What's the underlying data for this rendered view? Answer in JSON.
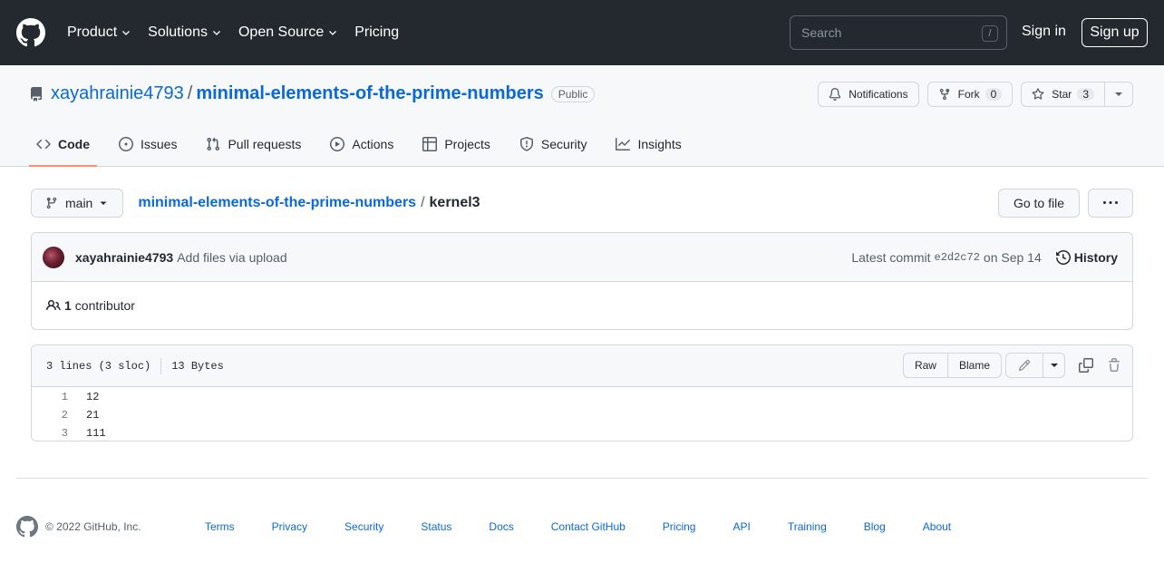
{
  "header": {
    "nav": [
      {
        "label": "Product",
        "dropdown": true
      },
      {
        "label": "Solutions",
        "dropdown": true
      },
      {
        "label": "Open Source",
        "dropdown": true
      },
      {
        "label": "Pricing",
        "dropdown": false
      }
    ],
    "search_placeholder": "Search",
    "search_shortcut": "/",
    "sign_in": "Sign in",
    "sign_up": "Sign up"
  },
  "repo": {
    "owner": "xayahrainie4793",
    "separator": "/",
    "name": "minimal-elements-of-the-prime-numbers",
    "visibility": "Public",
    "notifications_label": "Notifications",
    "fork_label": "Fork",
    "fork_count": "0",
    "star_label": "Star",
    "star_count": "3",
    "tabs": [
      {
        "label": "Code",
        "icon": "code-icon",
        "active": true
      },
      {
        "label": "Issues",
        "icon": "issue-icon",
        "active": false
      },
      {
        "label": "Pull requests",
        "icon": "pull-request-icon",
        "active": false
      },
      {
        "label": "Actions",
        "icon": "play-icon",
        "active": false
      },
      {
        "label": "Projects",
        "icon": "table-icon",
        "active": false
      },
      {
        "label": "Security",
        "icon": "shield-icon",
        "active": false
      },
      {
        "label": "Insights",
        "icon": "graph-icon",
        "active": false
      }
    ]
  },
  "file_nav": {
    "branch": "main",
    "repo_link": "minimal-elements-of-the-prime-numbers",
    "separator": "/",
    "file_name": "kernel3",
    "go_to_file": "Go to file"
  },
  "commit": {
    "author": "xayahrainie4793",
    "message": "Add files via upload",
    "latest_label": "Latest commit",
    "sha": "e2d2c72",
    "date": "on Sep 14",
    "history_label": "History",
    "contributors_count": "1",
    "contributors_label": "contributor"
  },
  "blob": {
    "lines_info": "3 lines (3 sloc)",
    "size": "13 Bytes",
    "raw_label": "Raw",
    "blame_label": "Blame",
    "lines": [
      {
        "num": "1",
        "code": "12"
      },
      {
        "num": "2",
        "code": "21"
      },
      {
        "num": "3",
        "code": "111"
      }
    ]
  },
  "footer": {
    "copyright": "© 2022 GitHub, Inc.",
    "links": [
      "Terms",
      "Privacy",
      "Security",
      "Status",
      "Docs",
      "Contact GitHub",
      "Pricing",
      "API",
      "Training",
      "Blog",
      "About"
    ]
  },
  "colors": {
    "header_bg": "#24292f",
    "link": "#0969da",
    "active_tab_underline": "#fd8c73"
  }
}
